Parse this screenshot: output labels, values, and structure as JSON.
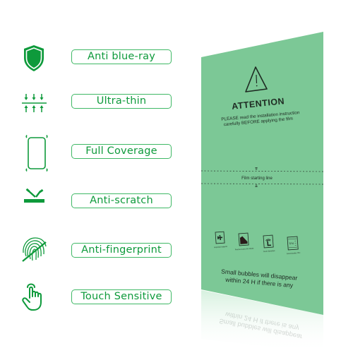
{
  "colors": {
    "accent_green": "#0e9a3b",
    "pill_border": "#3fb865",
    "film_green": "#7cc896",
    "film_text": "#1e2a22"
  },
  "features": [
    {
      "icon": "shield-icon",
      "label": "Anti blue-ray"
    },
    {
      "icon": "ultra-thin-arrows-icon",
      "label": "Ultra-thin"
    },
    {
      "icon": "phone-outline-icon",
      "label": "Full Coverage"
    },
    {
      "icon": "scratch-tools-icon",
      "label": "Anti-scratch"
    },
    {
      "icon": "fingerprint-crossed-icon",
      "label": "Anti-fingerprint"
    },
    {
      "icon": "touch-hand-icon",
      "label": "Touch Sensitive"
    }
  ],
  "film": {
    "warning_icon": "warning-triangle-icon",
    "title": "ATTENTION",
    "instruction_line1": "PLEASE read the installation instruction",
    "instruction_line2": "carefully BEFORE applying the film",
    "start_line_label": "Film  starting line",
    "badges": [
      {
        "icon": "airplane-icon",
        "caption": "Imported material"
      },
      {
        "icon": "mountain-icon",
        "caption": "Precise Cutout No Marks"
      },
      {
        "icon": "touch-icon",
        "caption": "Touch Sensitive"
      },
      {
        "icon": "tpu-layers-icon",
        "caption": "Good Quality TPU"
      }
    ],
    "badge_tpu_text": "TPU",
    "note_line1": "Small bubbles will disappear",
    "note_line2": "within 24 H if there is any"
  }
}
